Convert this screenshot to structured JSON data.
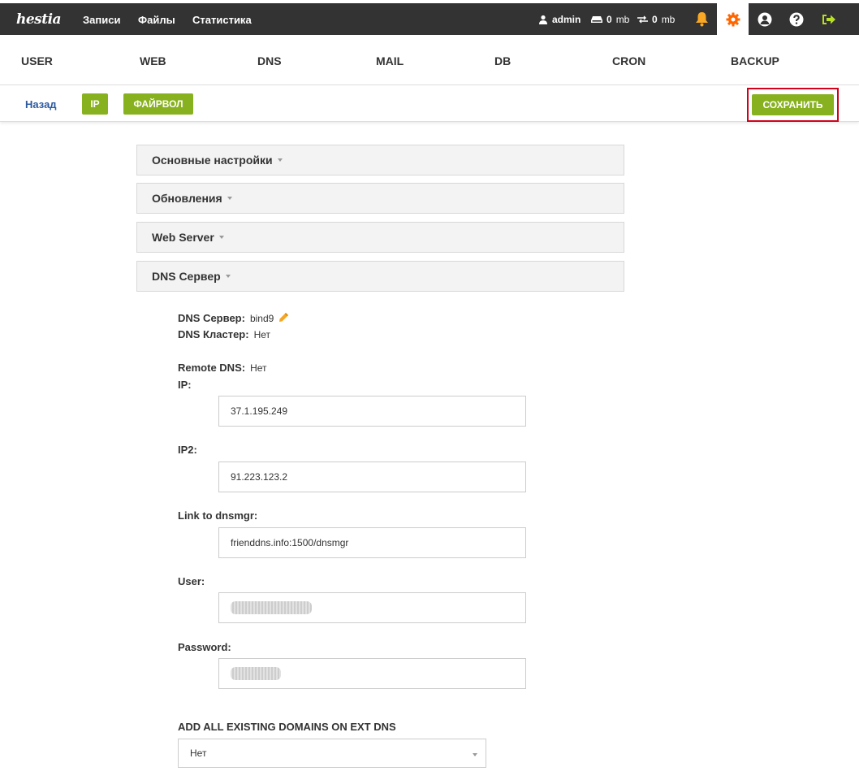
{
  "header": {
    "logo": "hestia",
    "nav": [
      "Записи",
      "Файлы",
      "Статистика"
    ],
    "user": "admin",
    "disk": {
      "value": "0",
      "unit": "mb"
    },
    "bandwidth": {
      "value": "0",
      "unit": "mb"
    },
    "icons": [
      "bell-icon",
      "gear-icon",
      "user-circle-icon",
      "help-icon",
      "logout-icon"
    ]
  },
  "tabs": [
    "USER",
    "WEB",
    "DNS",
    "MAIL",
    "DB",
    "CRON",
    "BACKUP"
  ],
  "toolbar": {
    "back": "Назад",
    "ip": "IP",
    "firewall": "ФАЙРВОЛ",
    "save": "СОХРАНИТЬ"
  },
  "sections": [
    "Основные настройки",
    "Обновления",
    "Web Server",
    "DNS Сервер"
  ],
  "dns": {
    "server_label": "DNS Сервер:",
    "server_value": "bind9",
    "cluster_label": "DNS Кластер:",
    "cluster_value": "Нет",
    "remote_label": "Remote DNS:",
    "remote_value": "Нет",
    "ip_label": "IP:",
    "ip_value": "37.1.195.249",
    "ip2_label": "IP2:",
    "ip2_value": "91.223.123.2",
    "link_label": "Link to dnsmgr:",
    "link_value": "frienddns.info:1500/dnsmgr",
    "user_label": "User:",
    "password_label": "Password:",
    "add_all_label": "ADD ALL EXISTING DOMAINS ON EXT DNS",
    "add_all_value": "Нет"
  },
  "colors": {
    "accent": "#87b11e",
    "bell": "#f9a825",
    "gear": "#ff6600",
    "highlight": "#d0021b",
    "link": "#2c5aa0"
  }
}
